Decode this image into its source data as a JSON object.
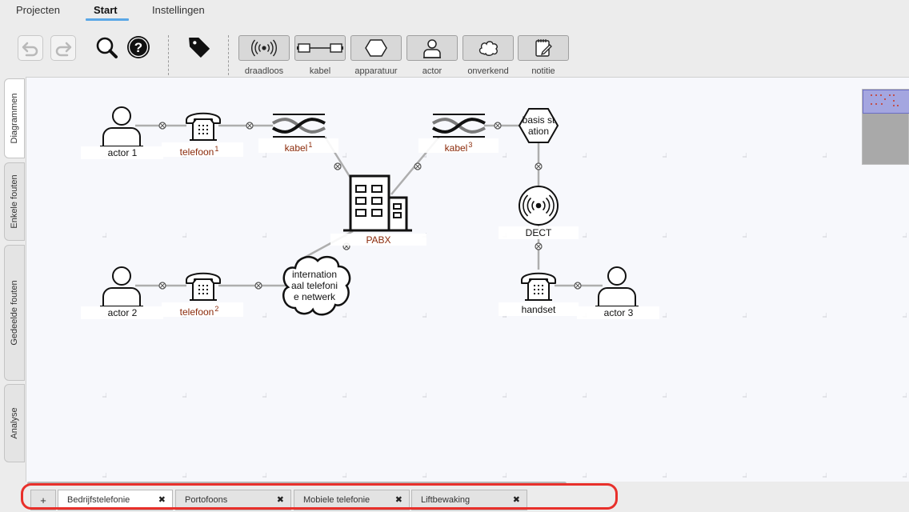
{
  "menu": {
    "projects": "Projecten",
    "start": "Start",
    "settings": "Instellingen"
  },
  "palette": [
    {
      "key": "wireless",
      "label": "draadloos",
      "icon": "wireless-icon"
    },
    {
      "key": "cable",
      "label": "kabel",
      "icon": "cable-icon"
    },
    {
      "key": "device",
      "label": "apparatuur",
      "icon": "hexagon-icon"
    },
    {
      "key": "actor",
      "label": "actor",
      "icon": "person-icon"
    },
    {
      "key": "unknown",
      "label": "onverkend",
      "icon": "cloud-icon"
    },
    {
      "key": "note",
      "label": "notitie",
      "icon": "note-icon"
    }
  ],
  "side_tabs": [
    "Diagrammen",
    "Enkele fouten",
    "Gedeelde fouten",
    "Analyse"
  ],
  "diagram": {
    "nodes": {
      "actor1": "actor 1",
      "actor2": "actor 2",
      "actor3": "actor 3",
      "phone1": "telefoon",
      "phone1_sup": "1",
      "phone2": "telefoon",
      "phone2_sup": "2",
      "cable1": "kabel",
      "cable1_sup": "1",
      "cable3": "kabel",
      "cable3_sup": "3",
      "pabx": "PABX",
      "base_line1": "basis st",
      "base_line2": "ation",
      "dect": "DECT",
      "handset": "handset",
      "cloud_line1": "internation",
      "cloud_line2": "aal telefoni",
      "cloud_line3": "e netwerk"
    }
  },
  "bottom_tabs": {
    "add_label": "+",
    "close_symbol": "✖",
    "tabs": [
      "Bedrijfstelefonie",
      "Portofoons",
      "Mobiele telefonie",
      "Liftbewaking"
    ]
  },
  "colors": {
    "accent": "#5aa7e6",
    "label_red": "#8b2a0a",
    "highlight": "#e8302b",
    "canvas": "#f7f8fc"
  }
}
